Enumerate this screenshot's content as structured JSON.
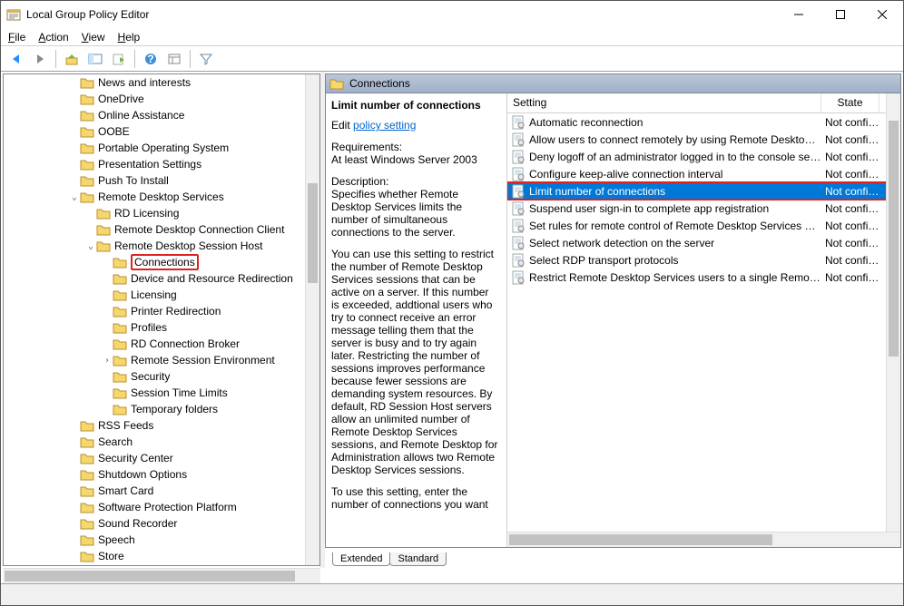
{
  "window": {
    "title": "Local Group Policy Editor"
  },
  "menu": {
    "file": "File",
    "action": "Action",
    "view": "View",
    "help": "Help"
  },
  "tree": {
    "items": [
      {
        "indent": 4,
        "label": "News and interests"
      },
      {
        "indent": 4,
        "label": "OneDrive"
      },
      {
        "indent": 4,
        "label": "Online Assistance"
      },
      {
        "indent": 4,
        "label": "OOBE"
      },
      {
        "indent": 4,
        "label": "Portable Operating System"
      },
      {
        "indent": 4,
        "label": "Presentation Settings"
      },
      {
        "indent": 4,
        "label": "Push To Install"
      },
      {
        "indent": 4,
        "label": "Remote Desktop Services",
        "expand": "v"
      },
      {
        "indent": 5,
        "label": "RD Licensing"
      },
      {
        "indent": 5,
        "label": "Remote Desktop Connection Client"
      },
      {
        "indent": 5,
        "label": "Remote Desktop Session Host",
        "expand": "v"
      },
      {
        "indent": 6,
        "label": "Connections",
        "selected": true
      },
      {
        "indent": 6,
        "label": "Device and Resource Redirection"
      },
      {
        "indent": 6,
        "label": "Licensing"
      },
      {
        "indent": 6,
        "label": "Printer Redirection"
      },
      {
        "indent": 6,
        "label": "Profiles"
      },
      {
        "indent": 6,
        "label": "RD Connection Broker"
      },
      {
        "indent": 6,
        "label": "Remote Session Environment",
        "expand": ">"
      },
      {
        "indent": 6,
        "label": "Security"
      },
      {
        "indent": 6,
        "label": "Session Time Limits"
      },
      {
        "indent": 6,
        "label": "Temporary folders"
      },
      {
        "indent": 4,
        "label": "RSS Feeds"
      },
      {
        "indent": 4,
        "label": "Search"
      },
      {
        "indent": 4,
        "label": "Security Center"
      },
      {
        "indent": 4,
        "label": "Shutdown Options"
      },
      {
        "indent": 4,
        "label": "Smart Card"
      },
      {
        "indent": 4,
        "label": "Software Protection Platform"
      },
      {
        "indent": 4,
        "label": "Sound Recorder"
      },
      {
        "indent": 4,
        "label": "Speech"
      },
      {
        "indent": 4,
        "label": "Store"
      }
    ]
  },
  "right": {
    "header": "Connections",
    "desc_title": "Limit number of connections",
    "edit_label": "Edit",
    "link": "policy setting",
    "req_label": "Requirements:",
    "req_text": "At least Windows Server 2003",
    "desc_label": "Description:",
    "desc_text1": "Specifies whether Remote Desktop Services limits the number of simultaneous connections to the server.",
    "desc_text2": "You can use this setting to restrict the number of Remote Desktop Services sessions that can be active on a server. If this number is exceeded, addtional users who try to connect receive an error message telling them that the server is busy and to try again later. Restricting the number of sessions improves performance because fewer sessions are demanding system resources. By default, RD Session Host servers allow an unlimited number of Remote Desktop Services sessions, and Remote Desktop for Administration allows two Remote Desktop Services sessions.",
    "desc_text3": "To use this setting, enter the number of connections you want",
    "columns": {
      "setting": "Setting",
      "state": "State"
    },
    "rows": [
      {
        "setting": "Automatic reconnection",
        "state": "Not configur"
      },
      {
        "setting": "Allow users to connect remotely by using Remote Desktop S...",
        "state": "Not configur"
      },
      {
        "setting": "Deny logoff of an administrator logged in to the console ses...",
        "state": "Not configur"
      },
      {
        "setting": "Configure keep-alive connection interval",
        "state": "Not configur"
      },
      {
        "setting": "Limit number of connections",
        "state": "Not configur",
        "selected": true
      },
      {
        "setting": "Suspend user sign-in to complete app registration",
        "state": "Not configur"
      },
      {
        "setting": "Set rules for remote control of Remote Desktop Services use...",
        "state": "Not configur"
      },
      {
        "setting": "Select network detection on the server",
        "state": "Not configur"
      },
      {
        "setting": "Select RDP transport protocols",
        "state": "Not configur"
      },
      {
        "setting": "Restrict Remote Desktop Services users to a single Remote D...",
        "state": "Not configur"
      }
    ],
    "tabs": {
      "extended": "Extended",
      "standard": "Standard"
    }
  }
}
